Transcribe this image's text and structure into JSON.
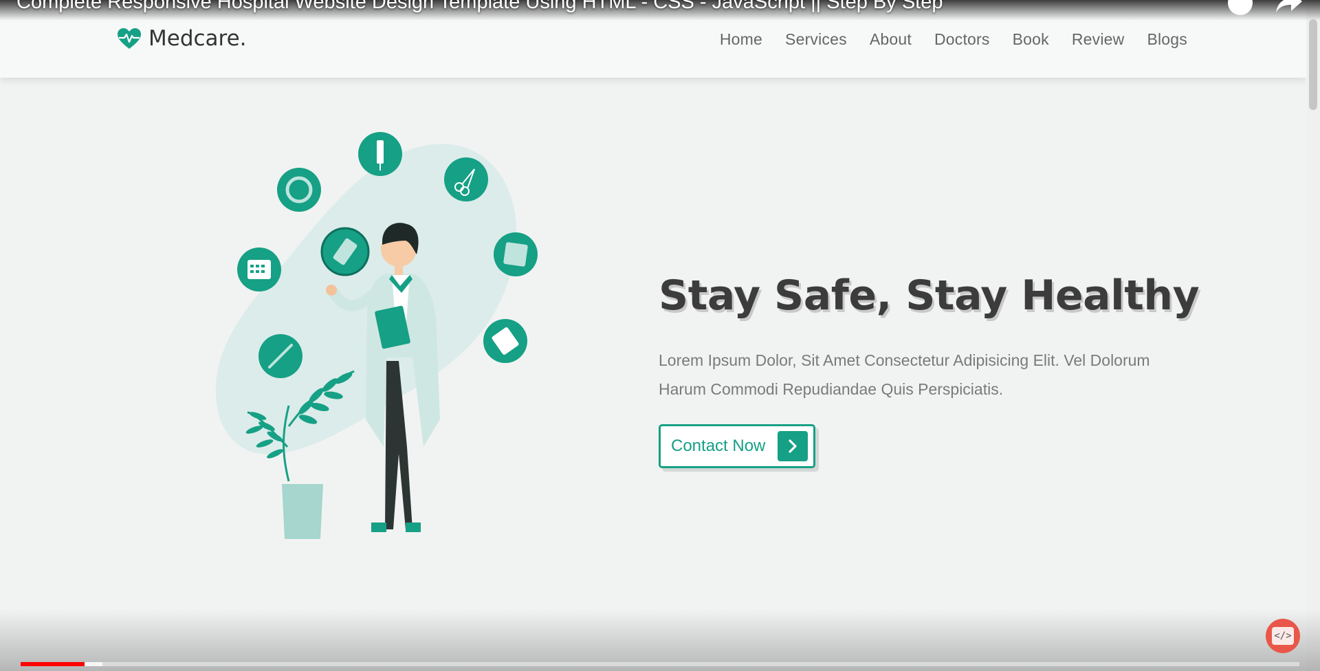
{
  "player": {
    "video_title": "Complete Responsive Hospital Website Design Template Using HTML - CSS - JavaScript || Step By Step",
    "progress_fraction": 0.05,
    "buffer_fraction": 0.064
  },
  "header": {
    "logo_text": "Medcare.",
    "nav": [
      "Home",
      "Services",
      "About",
      "Doctors",
      "Book",
      "Review",
      "Blogs"
    ]
  },
  "hero": {
    "title": "Stay Safe, Stay Healthy",
    "text": "Lorem Ipsum Dolor, Sit Amet Consectetur Adipisicing Elit. Vel Dolorum Harum Commodi Repudiandae Quis Perspiciatis.",
    "button_label": "Contact Now"
  },
  "badge": {
    "text": "</>"
  },
  "colors": {
    "accent": "#16a085",
    "title": "#3c3c3c",
    "progress": "#ff0000"
  }
}
